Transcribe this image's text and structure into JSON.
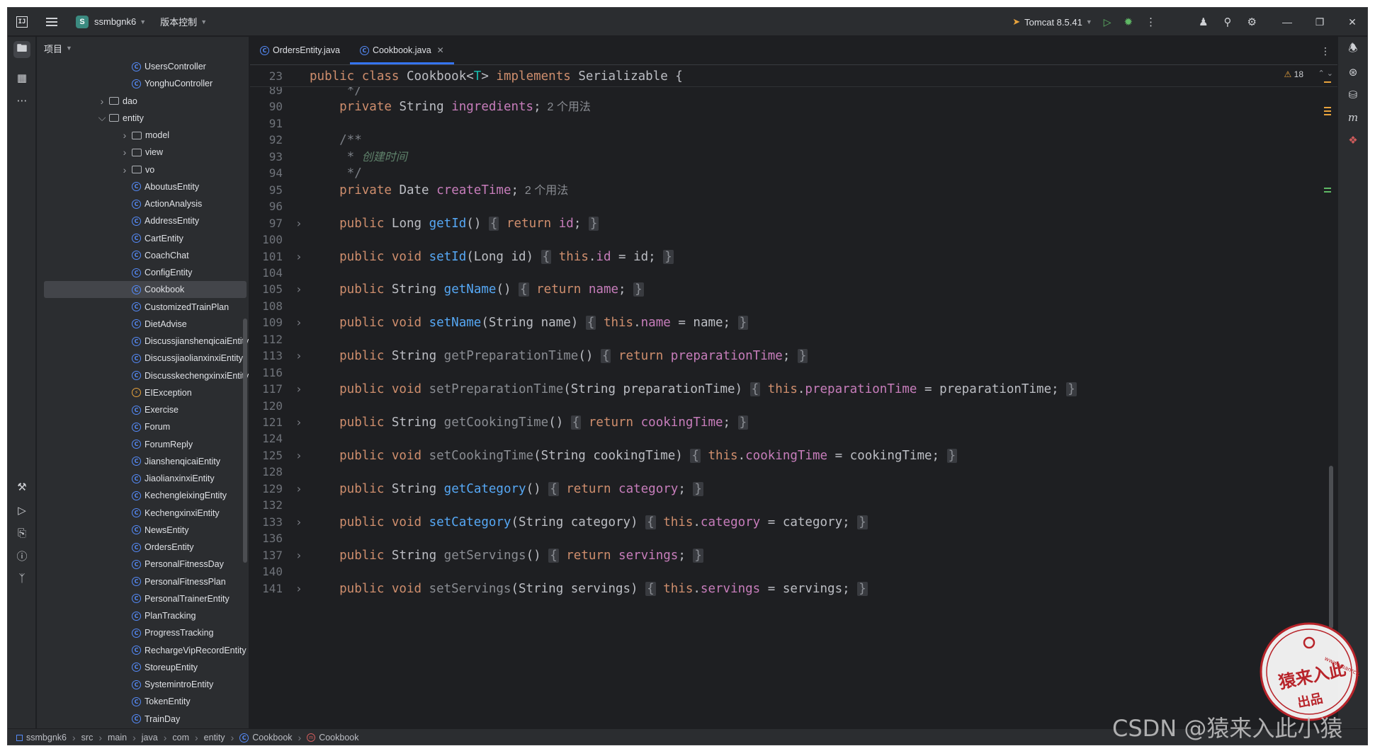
{
  "titlebar": {
    "app_icon": "intellij-icon",
    "project_badge": "S",
    "project_name": "ssmbgnk6",
    "vcs_label": "版本控制",
    "run_config": "Tomcat 8.5.41"
  },
  "project_panel": {
    "title": "项目",
    "tree": [
      {
        "label": "UsersController",
        "kind": "class",
        "indent": 3
      },
      {
        "label": "YonghuController",
        "kind": "class",
        "indent": 3
      },
      {
        "label": "dao",
        "kind": "folder",
        "indent": 2,
        "expanded": false
      },
      {
        "label": "entity",
        "kind": "folder",
        "indent": 2,
        "expanded": true
      },
      {
        "label": "model",
        "kind": "folder",
        "indent": 3,
        "expanded": false
      },
      {
        "label": "view",
        "kind": "folder",
        "indent": 3,
        "expanded": false
      },
      {
        "label": "vo",
        "kind": "folder",
        "indent": 3,
        "expanded": false
      },
      {
        "label": "AboutusEntity",
        "kind": "class",
        "indent": 3
      },
      {
        "label": "ActionAnalysis",
        "kind": "class",
        "indent": 3
      },
      {
        "label": "AddressEntity",
        "kind": "class",
        "indent": 3
      },
      {
        "label": "CartEntity",
        "kind": "class",
        "indent": 3
      },
      {
        "label": "CoachChat",
        "kind": "class",
        "indent": 3
      },
      {
        "label": "ConfigEntity",
        "kind": "class",
        "indent": 3
      },
      {
        "label": "Cookbook",
        "kind": "class",
        "indent": 3,
        "selected": true
      },
      {
        "label": "CustomizedTrainPlan",
        "kind": "class",
        "indent": 3
      },
      {
        "label": "DietAdvise",
        "kind": "class",
        "indent": 3
      },
      {
        "label": "DiscussjianshenqicaiEntity",
        "kind": "class",
        "indent": 3
      },
      {
        "label": "DiscussjiaolianxinxiEntity",
        "kind": "class",
        "indent": 3
      },
      {
        "label": "DiscusskechengxinxiEntity",
        "kind": "class",
        "indent": 3
      },
      {
        "label": "EIException",
        "kind": "exception",
        "indent": 3
      },
      {
        "label": "Exercise",
        "kind": "class",
        "indent": 3
      },
      {
        "label": "Forum",
        "kind": "class",
        "indent": 3
      },
      {
        "label": "ForumReply",
        "kind": "class",
        "indent": 3
      },
      {
        "label": "JianshenqicaiEntity",
        "kind": "class",
        "indent": 3
      },
      {
        "label": "JiaolianxinxiEntity",
        "kind": "class",
        "indent": 3
      },
      {
        "label": "KechengleixingEntity",
        "kind": "class",
        "indent": 3
      },
      {
        "label": "KechengxinxiEntity",
        "kind": "class",
        "indent": 3
      },
      {
        "label": "NewsEntity",
        "kind": "class",
        "indent": 3
      },
      {
        "label": "OrdersEntity",
        "kind": "class",
        "indent": 3
      },
      {
        "label": "PersonalFitnessDay",
        "kind": "class",
        "indent": 3
      },
      {
        "label": "PersonalFitnessPlan",
        "kind": "class",
        "indent": 3
      },
      {
        "label": "PersonalTrainerEntity",
        "kind": "class",
        "indent": 3
      },
      {
        "label": "PlanTracking",
        "kind": "class",
        "indent": 3
      },
      {
        "label": "ProgressTracking",
        "kind": "class",
        "indent": 3
      },
      {
        "label": "RechargeVipRecordEntity",
        "kind": "class",
        "indent": 3
      },
      {
        "label": "StoreupEntity",
        "kind": "class",
        "indent": 3
      },
      {
        "label": "SystemintroEntity",
        "kind": "class",
        "indent": 3
      },
      {
        "label": "TokenEntity",
        "kind": "class",
        "indent": 3
      },
      {
        "label": "TrainDay",
        "kind": "class",
        "indent": 3
      }
    ]
  },
  "tabs": [
    {
      "label": "OrdersEntity.java",
      "active": false
    },
    {
      "label": "Cookbook.java",
      "active": true
    }
  ],
  "editor": {
    "warning_count": "18",
    "sticky": {
      "ln": "23",
      "tokens": [
        [
          "kw",
          "public class "
        ],
        [
          "type",
          "Cookbook<"
        ],
        [
          "generic",
          "T"
        ],
        [
          "type",
          "> "
        ],
        [
          "kw",
          "implements "
        ],
        [
          "type",
          "Serializable {"
        ]
      ]
    },
    "lines": [
      {
        "ln": "89",
        "tokens": [
          [
            "cm",
            "     */"
          ]
        ]
      },
      {
        "ln": "90",
        "tokens": [
          [
            "kw",
            "    private "
          ],
          [
            "type",
            "String "
          ],
          [
            "field",
            "ingredients"
          ],
          [
            "type",
            ";"
          ],
          [
            "hint",
            "  2 个用法"
          ]
        ]
      },
      {
        "ln": "91",
        "tokens": []
      },
      {
        "ln": "92",
        "tokens": [
          [
            "cm",
            "    /**"
          ]
        ]
      },
      {
        "ln": "93",
        "tokens": [
          [
            "cm",
            "     * "
          ],
          [
            "cmi",
            "创建时间"
          ]
        ]
      },
      {
        "ln": "94",
        "tokens": [
          [
            "cm",
            "     */"
          ]
        ]
      },
      {
        "ln": "95",
        "tokens": [
          [
            "kw",
            "    private "
          ],
          [
            "type",
            "Date "
          ],
          [
            "field",
            "createTime"
          ],
          [
            "type",
            ";"
          ],
          [
            "hint",
            "  2 个用法"
          ]
        ]
      },
      {
        "ln": "96",
        "tokens": []
      },
      {
        "ln": "97",
        "fold": true,
        "tokens": [
          [
            "kw",
            "    public "
          ],
          [
            "type",
            "Long "
          ],
          [
            "fn",
            "getId"
          ],
          [
            "type",
            "() "
          ],
          [
            "brace",
            "{"
          ],
          [
            "kw",
            " return "
          ],
          [
            "field",
            "id"
          ],
          [
            "type",
            "; "
          ],
          [
            "brace",
            "}"
          ]
        ]
      },
      {
        "ln": "100",
        "tokens": []
      },
      {
        "ln": "101",
        "fold": true,
        "tokens": [
          [
            "kw",
            "    public void "
          ],
          [
            "fn",
            "setId"
          ],
          [
            "type",
            "(Long id) "
          ],
          [
            "brace",
            "{"
          ],
          [
            "kw",
            " this"
          ],
          [
            "type",
            "."
          ],
          [
            "field",
            "id"
          ],
          [
            "type",
            " = id; "
          ],
          [
            "brace",
            "}"
          ]
        ]
      },
      {
        "ln": "104",
        "tokens": []
      },
      {
        "ln": "105",
        "fold": true,
        "tokens": [
          [
            "kw",
            "    public "
          ],
          [
            "type",
            "String "
          ],
          [
            "fn",
            "getName"
          ],
          [
            "type",
            "() "
          ],
          [
            "brace",
            "{"
          ],
          [
            "kw",
            " return "
          ],
          [
            "field",
            "name"
          ],
          [
            "type",
            "; "
          ],
          [
            "brace",
            "}"
          ]
        ]
      },
      {
        "ln": "108",
        "tokens": []
      },
      {
        "ln": "109",
        "fold": true,
        "tokens": [
          [
            "kw",
            "    public void "
          ],
          [
            "fn",
            "setName"
          ],
          [
            "type",
            "(String name) "
          ],
          [
            "brace",
            "{"
          ],
          [
            "kw",
            " this"
          ],
          [
            "type",
            "."
          ],
          [
            "field",
            "name"
          ],
          [
            "type",
            " = name; "
          ],
          [
            "brace",
            "}"
          ]
        ]
      },
      {
        "ln": "112",
        "tokens": []
      },
      {
        "ln": "113",
        "fold": true,
        "tokens": [
          [
            "kw",
            "    public "
          ],
          [
            "type",
            "String "
          ],
          [
            "fn-unused",
            "getPreparationTime"
          ],
          [
            "type",
            "() "
          ],
          [
            "brace",
            "{"
          ],
          [
            "kw",
            " return "
          ],
          [
            "field",
            "preparationTime"
          ],
          [
            "type",
            "; "
          ],
          [
            "brace",
            "}"
          ]
        ]
      },
      {
        "ln": "116",
        "tokens": []
      },
      {
        "ln": "117",
        "fold": true,
        "tokens": [
          [
            "kw",
            "    public void "
          ],
          [
            "fn-unused",
            "setPreparationTime"
          ],
          [
            "type",
            "(String preparationTime) "
          ],
          [
            "brace",
            "{"
          ],
          [
            "kw",
            " this"
          ],
          [
            "type",
            "."
          ],
          [
            "field",
            "preparationTime"
          ],
          [
            "type",
            " = preparationTime; "
          ],
          [
            "brace",
            "}"
          ]
        ]
      },
      {
        "ln": "120",
        "tokens": []
      },
      {
        "ln": "121",
        "fold": true,
        "tokens": [
          [
            "kw",
            "    public "
          ],
          [
            "type",
            "String "
          ],
          [
            "fn-unused",
            "getCookingTime"
          ],
          [
            "type",
            "() "
          ],
          [
            "brace",
            "{"
          ],
          [
            "kw",
            " return "
          ],
          [
            "field",
            "cookingTime"
          ],
          [
            "type",
            "; "
          ],
          [
            "brace",
            "}"
          ]
        ]
      },
      {
        "ln": "124",
        "tokens": []
      },
      {
        "ln": "125",
        "fold": true,
        "tokens": [
          [
            "kw",
            "    public void "
          ],
          [
            "fn-unused",
            "setCookingTime"
          ],
          [
            "type",
            "(String cookingTime) "
          ],
          [
            "brace",
            "{"
          ],
          [
            "kw",
            " this"
          ],
          [
            "type",
            "."
          ],
          [
            "field",
            "cookingTime"
          ],
          [
            "type",
            " = cookingTime; "
          ],
          [
            "brace",
            "}"
          ]
        ]
      },
      {
        "ln": "128",
        "tokens": []
      },
      {
        "ln": "129",
        "fold": true,
        "tokens": [
          [
            "kw",
            "    public "
          ],
          [
            "type",
            "String "
          ],
          [
            "fn",
            "getCategory"
          ],
          [
            "type",
            "() "
          ],
          [
            "brace",
            "{"
          ],
          [
            "kw",
            " return "
          ],
          [
            "field",
            "category"
          ],
          [
            "type",
            "; "
          ],
          [
            "brace",
            "}"
          ]
        ]
      },
      {
        "ln": "132",
        "tokens": []
      },
      {
        "ln": "133",
        "fold": true,
        "tokens": [
          [
            "kw",
            "    public void "
          ],
          [
            "fn",
            "setCategory"
          ],
          [
            "type",
            "(String category) "
          ],
          [
            "brace",
            "{"
          ],
          [
            "kw",
            " this"
          ],
          [
            "type",
            "."
          ],
          [
            "field",
            "category"
          ],
          [
            "type",
            " = category; "
          ],
          [
            "brace",
            "}"
          ]
        ]
      },
      {
        "ln": "136",
        "tokens": []
      },
      {
        "ln": "137",
        "fold": true,
        "tokens": [
          [
            "kw",
            "    public "
          ],
          [
            "type",
            "String "
          ],
          [
            "fn-unused",
            "getServings"
          ],
          [
            "type",
            "() "
          ],
          [
            "brace",
            "{"
          ],
          [
            "kw",
            " return "
          ],
          [
            "field",
            "servings"
          ],
          [
            "type",
            "; "
          ],
          [
            "brace",
            "}"
          ]
        ]
      },
      {
        "ln": "140",
        "tokens": []
      },
      {
        "ln": "141",
        "fold": true,
        "tokens": [
          [
            "kw",
            "    public void "
          ],
          [
            "fn-unused",
            "setServings"
          ],
          [
            "type",
            "(String servings) "
          ],
          [
            "brace",
            "{"
          ],
          [
            "kw",
            " this"
          ],
          [
            "type",
            "."
          ],
          [
            "field",
            "servings"
          ],
          [
            "type",
            " = servings; "
          ],
          [
            "brace",
            "}"
          ]
        ]
      }
    ]
  },
  "statusbar": {
    "breadcrumbs": [
      "ssmbgnk6",
      "src",
      "main",
      "java",
      "com",
      "entity",
      "Cookbook",
      "Cookbook"
    ]
  },
  "watermark": {
    "text": "CSDN @猿来入此小猿",
    "stamp_url": "www.yuanrc.com",
    "stamp_main": "猿来入此",
    "stamp_sub": "出品"
  },
  "colors": {
    "background": "#1e1f22",
    "panel": "#2b2d30",
    "accent": "#3574f0",
    "keyword": "#cf8e6d",
    "method": "#56a8f5",
    "field": "#c77dbb"
  }
}
